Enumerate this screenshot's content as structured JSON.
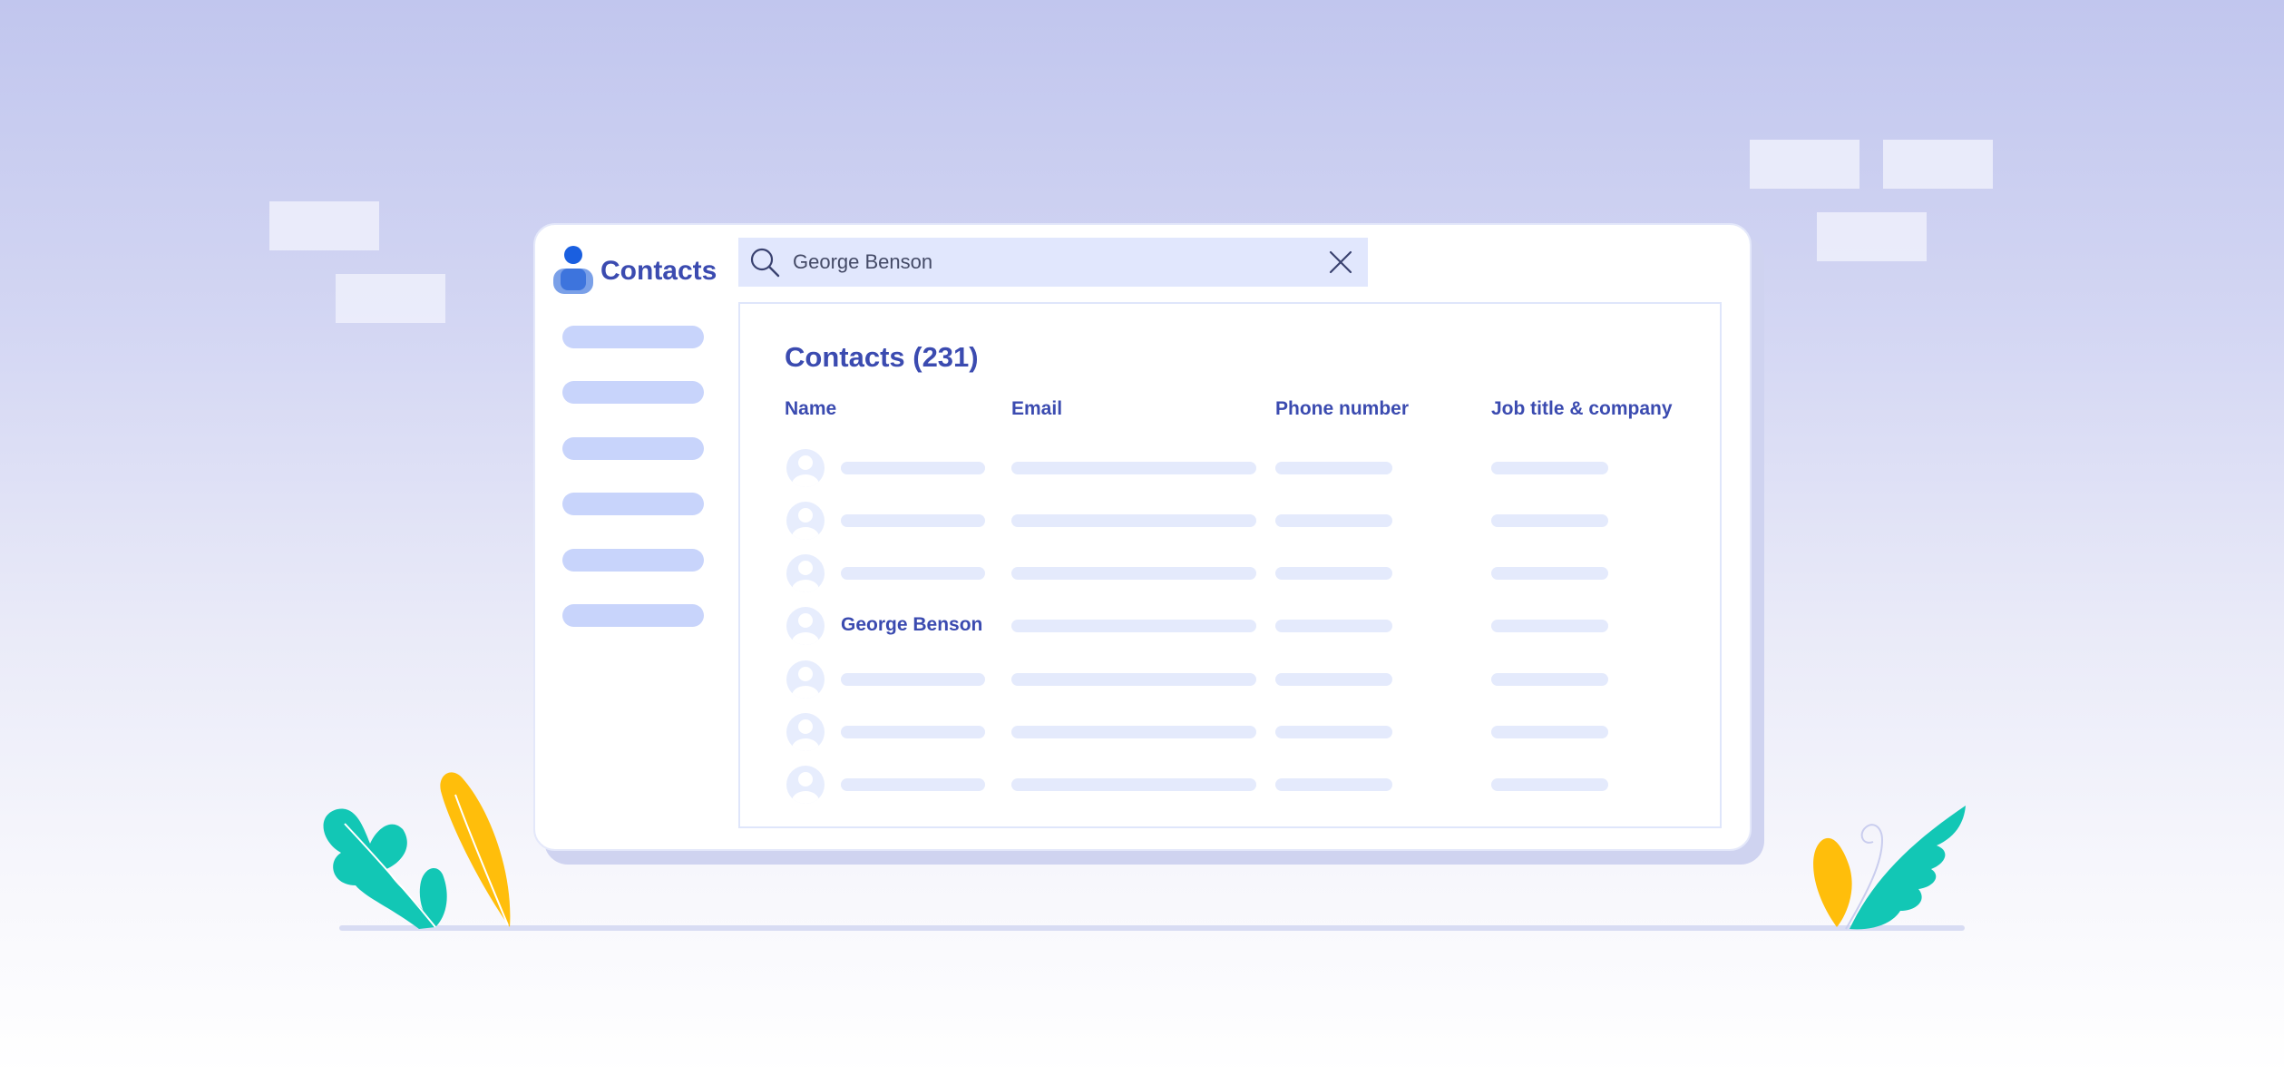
{
  "app": {
    "brand_label": "Contacts",
    "icon": "person-icon"
  },
  "search": {
    "value": "George Benson",
    "icon": "search-icon",
    "clear_icon": "close-icon"
  },
  "contacts": {
    "title": "Contacts (231)",
    "columns": [
      "Name",
      "Email",
      "Phone number",
      "Job title & company"
    ],
    "highlighted_name": "George Benson"
  },
  "colors": {
    "accent": "#3b4bb0",
    "brand_blue": "#1a5fe0",
    "placeholder_bar": "#e4eafc",
    "nav_bar": "#c8d4fb",
    "leaf_teal": "#12c7b5",
    "leaf_yellow": "#ffbe0b"
  }
}
